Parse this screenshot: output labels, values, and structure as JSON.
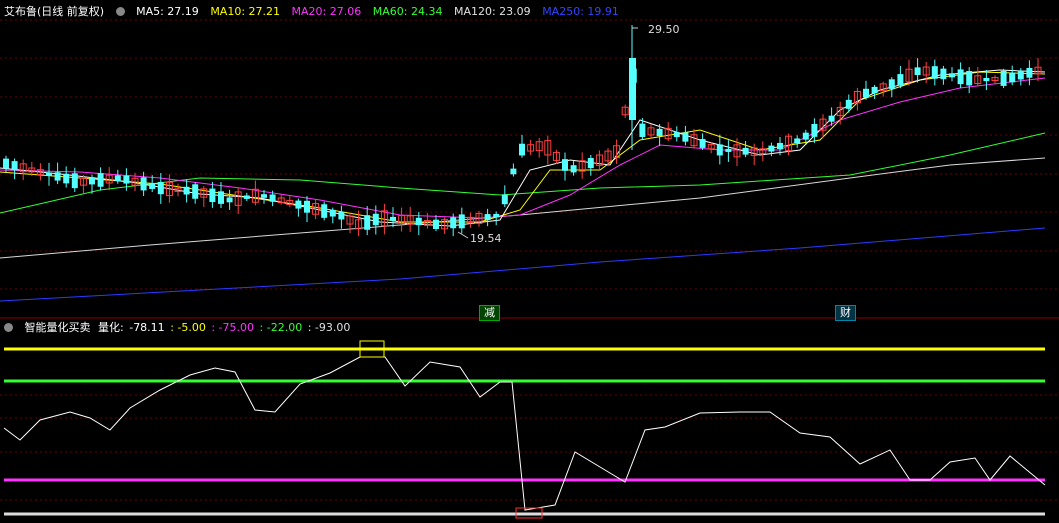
{
  "main_header": {
    "title": "艾布鲁(日线 前复权)",
    "ma5": "MA5: 27.19",
    "ma10": "MA10: 27.21",
    "ma20": "MA20: 27.06",
    "ma60": "MA60: 24.34",
    "ma120": "MA120: 23.09",
    "ma250": "MA250: 19.91",
    "colors": {
      "ma5": "#ffffff",
      "ma10": "#ffff00",
      "ma20": "#ff00ff",
      "ma60": "#00ff00",
      "ma120": "#e0e0e0",
      "ma250": "#2b3bff"
    }
  },
  "annotations": {
    "high": "29.50",
    "low": "19.54",
    "marker_reduce": "减",
    "marker_finance": "财"
  },
  "sub_header": {
    "title": "智能量化买卖",
    "label": "量化:",
    "v1": "-78.11",
    "v2": ": -5.00",
    "v3": ": -75.00",
    "v4": ": -22.00",
    "v5": ": -93.00"
  },
  "chart_data": {
    "type": "candlestick",
    "price_range": [
      18.5,
      30.5
    ],
    "indicator_levels": [
      -5.0,
      -22.0,
      -75.0,
      -93.0
    ],
    "indicator_range": [
      -95,
      0
    ],
    "colors": {
      "up": "#ff3b3b",
      "down": "#54ffff",
      "grid": "#7a0000"
    }
  }
}
